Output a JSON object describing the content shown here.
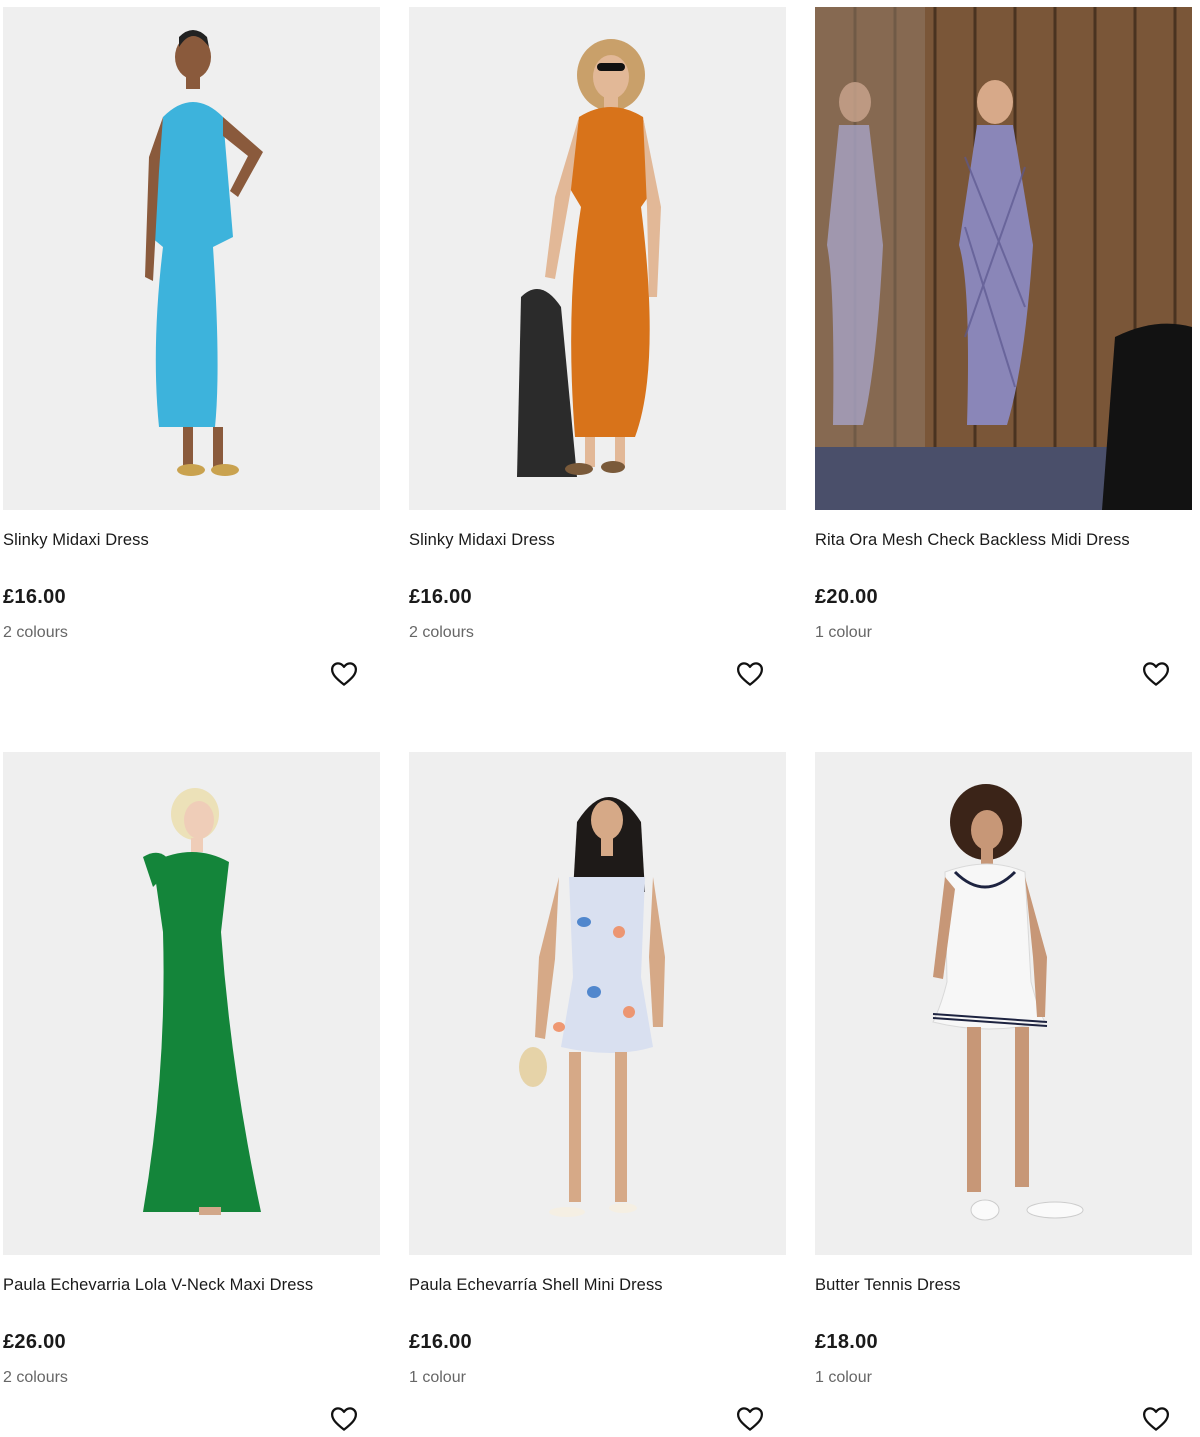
{
  "products": [
    {
      "title": "Slinky Midaxi Dress",
      "price": "£16.00",
      "colours": "2 colours",
      "wishlist_icon": "heart-outline-icon",
      "swatch": "#3db3dc"
    },
    {
      "title": "Slinky Midaxi Dress",
      "price": "£16.00",
      "colours": "2 colours",
      "wishlist_icon": "heart-outline-icon",
      "swatch": "#d8731a"
    },
    {
      "title": "Rita Ora Mesh Check Backless Midi Dress",
      "price": "£20.00",
      "colours": "1 colour",
      "wishlist_icon": "heart-outline-icon",
      "swatch": "#8a86b8"
    },
    {
      "title": "Paula Echevarria Lola V-Neck Maxi Dress",
      "price": "£26.00",
      "colours": "2 colours",
      "wishlist_icon": "heart-outline-icon",
      "swatch": "#14853a"
    },
    {
      "title": "Paula Echevarría Shell Mini Dress",
      "price": "£16.00",
      "colours": "1 colour",
      "wishlist_icon": "heart-outline-icon",
      "swatch": "#d9e0f0"
    },
    {
      "title": "Butter Tennis Dress",
      "price": "£18.00",
      "colours": "1 colour",
      "wishlist_icon": "heart-outline-icon",
      "swatch": "#f7f7f7"
    }
  ]
}
